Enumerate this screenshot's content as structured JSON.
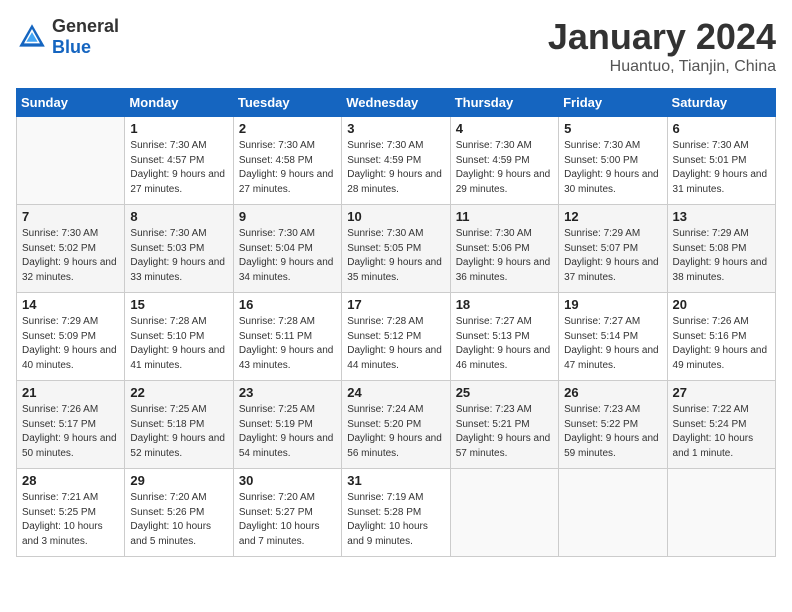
{
  "header": {
    "logo_general": "General",
    "logo_blue": "Blue",
    "title": "January 2024",
    "location": "Huantuo, Tianjin, China"
  },
  "days_of_week": [
    "Sunday",
    "Monday",
    "Tuesday",
    "Wednesday",
    "Thursday",
    "Friday",
    "Saturday"
  ],
  "weeks": [
    [
      {
        "num": "",
        "sunrise": "",
        "sunset": "",
        "daylight": "",
        "empty": true
      },
      {
        "num": "1",
        "sunrise": "Sunrise: 7:30 AM",
        "sunset": "Sunset: 4:57 PM",
        "daylight": "Daylight: 9 hours and 27 minutes."
      },
      {
        "num": "2",
        "sunrise": "Sunrise: 7:30 AM",
        "sunset": "Sunset: 4:58 PM",
        "daylight": "Daylight: 9 hours and 27 minutes."
      },
      {
        "num": "3",
        "sunrise": "Sunrise: 7:30 AM",
        "sunset": "Sunset: 4:59 PM",
        "daylight": "Daylight: 9 hours and 28 minutes."
      },
      {
        "num": "4",
        "sunrise": "Sunrise: 7:30 AM",
        "sunset": "Sunset: 4:59 PM",
        "daylight": "Daylight: 9 hours and 29 minutes."
      },
      {
        "num": "5",
        "sunrise": "Sunrise: 7:30 AM",
        "sunset": "Sunset: 5:00 PM",
        "daylight": "Daylight: 9 hours and 30 minutes."
      },
      {
        "num": "6",
        "sunrise": "Sunrise: 7:30 AM",
        "sunset": "Sunset: 5:01 PM",
        "daylight": "Daylight: 9 hours and 31 minutes."
      }
    ],
    [
      {
        "num": "7",
        "sunrise": "Sunrise: 7:30 AM",
        "sunset": "Sunset: 5:02 PM",
        "daylight": "Daylight: 9 hours and 32 minutes."
      },
      {
        "num": "8",
        "sunrise": "Sunrise: 7:30 AM",
        "sunset": "Sunset: 5:03 PM",
        "daylight": "Daylight: 9 hours and 33 minutes."
      },
      {
        "num": "9",
        "sunrise": "Sunrise: 7:30 AM",
        "sunset": "Sunset: 5:04 PM",
        "daylight": "Daylight: 9 hours and 34 minutes."
      },
      {
        "num": "10",
        "sunrise": "Sunrise: 7:30 AM",
        "sunset": "Sunset: 5:05 PM",
        "daylight": "Daylight: 9 hours and 35 minutes."
      },
      {
        "num": "11",
        "sunrise": "Sunrise: 7:30 AM",
        "sunset": "Sunset: 5:06 PM",
        "daylight": "Daylight: 9 hours and 36 minutes."
      },
      {
        "num": "12",
        "sunrise": "Sunrise: 7:29 AM",
        "sunset": "Sunset: 5:07 PM",
        "daylight": "Daylight: 9 hours and 37 minutes."
      },
      {
        "num": "13",
        "sunrise": "Sunrise: 7:29 AM",
        "sunset": "Sunset: 5:08 PM",
        "daylight": "Daylight: 9 hours and 38 minutes."
      }
    ],
    [
      {
        "num": "14",
        "sunrise": "Sunrise: 7:29 AM",
        "sunset": "Sunset: 5:09 PM",
        "daylight": "Daylight: 9 hours and 40 minutes."
      },
      {
        "num": "15",
        "sunrise": "Sunrise: 7:28 AM",
        "sunset": "Sunset: 5:10 PM",
        "daylight": "Daylight: 9 hours and 41 minutes."
      },
      {
        "num": "16",
        "sunrise": "Sunrise: 7:28 AM",
        "sunset": "Sunset: 5:11 PM",
        "daylight": "Daylight: 9 hours and 43 minutes."
      },
      {
        "num": "17",
        "sunrise": "Sunrise: 7:28 AM",
        "sunset": "Sunset: 5:12 PM",
        "daylight": "Daylight: 9 hours and 44 minutes."
      },
      {
        "num": "18",
        "sunrise": "Sunrise: 7:27 AM",
        "sunset": "Sunset: 5:13 PM",
        "daylight": "Daylight: 9 hours and 46 minutes."
      },
      {
        "num": "19",
        "sunrise": "Sunrise: 7:27 AM",
        "sunset": "Sunset: 5:14 PM",
        "daylight": "Daylight: 9 hours and 47 minutes."
      },
      {
        "num": "20",
        "sunrise": "Sunrise: 7:26 AM",
        "sunset": "Sunset: 5:16 PM",
        "daylight": "Daylight: 9 hours and 49 minutes."
      }
    ],
    [
      {
        "num": "21",
        "sunrise": "Sunrise: 7:26 AM",
        "sunset": "Sunset: 5:17 PM",
        "daylight": "Daylight: 9 hours and 50 minutes."
      },
      {
        "num": "22",
        "sunrise": "Sunrise: 7:25 AM",
        "sunset": "Sunset: 5:18 PM",
        "daylight": "Daylight: 9 hours and 52 minutes."
      },
      {
        "num": "23",
        "sunrise": "Sunrise: 7:25 AM",
        "sunset": "Sunset: 5:19 PM",
        "daylight": "Daylight: 9 hours and 54 minutes."
      },
      {
        "num": "24",
        "sunrise": "Sunrise: 7:24 AM",
        "sunset": "Sunset: 5:20 PM",
        "daylight": "Daylight: 9 hours and 56 minutes."
      },
      {
        "num": "25",
        "sunrise": "Sunrise: 7:23 AM",
        "sunset": "Sunset: 5:21 PM",
        "daylight": "Daylight: 9 hours and 57 minutes."
      },
      {
        "num": "26",
        "sunrise": "Sunrise: 7:23 AM",
        "sunset": "Sunset: 5:22 PM",
        "daylight": "Daylight: 9 hours and 59 minutes."
      },
      {
        "num": "27",
        "sunrise": "Sunrise: 7:22 AM",
        "sunset": "Sunset: 5:24 PM",
        "daylight": "Daylight: 10 hours and 1 minute."
      }
    ],
    [
      {
        "num": "28",
        "sunrise": "Sunrise: 7:21 AM",
        "sunset": "Sunset: 5:25 PM",
        "daylight": "Daylight: 10 hours and 3 minutes."
      },
      {
        "num": "29",
        "sunrise": "Sunrise: 7:20 AM",
        "sunset": "Sunset: 5:26 PM",
        "daylight": "Daylight: 10 hours and 5 minutes."
      },
      {
        "num": "30",
        "sunrise": "Sunrise: 7:20 AM",
        "sunset": "Sunset: 5:27 PM",
        "daylight": "Daylight: 10 hours and 7 minutes."
      },
      {
        "num": "31",
        "sunrise": "Sunrise: 7:19 AM",
        "sunset": "Sunset: 5:28 PM",
        "daylight": "Daylight: 10 hours and 9 minutes."
      },
      {
        "num": "",
        "sunrise": "",
        "sunset": "",
        "daylight": "",
        "empty": true
      },
      {
        "num": "",
        "sunrise": "",
        "sunset": "",
        "daylight": "",
        "empty": true
      },
      {
        "num": "",
        "sunrise": "",
        "sunset": "",
        "daylight": "",
        "empty": true
      }
    ]
  ]
}
